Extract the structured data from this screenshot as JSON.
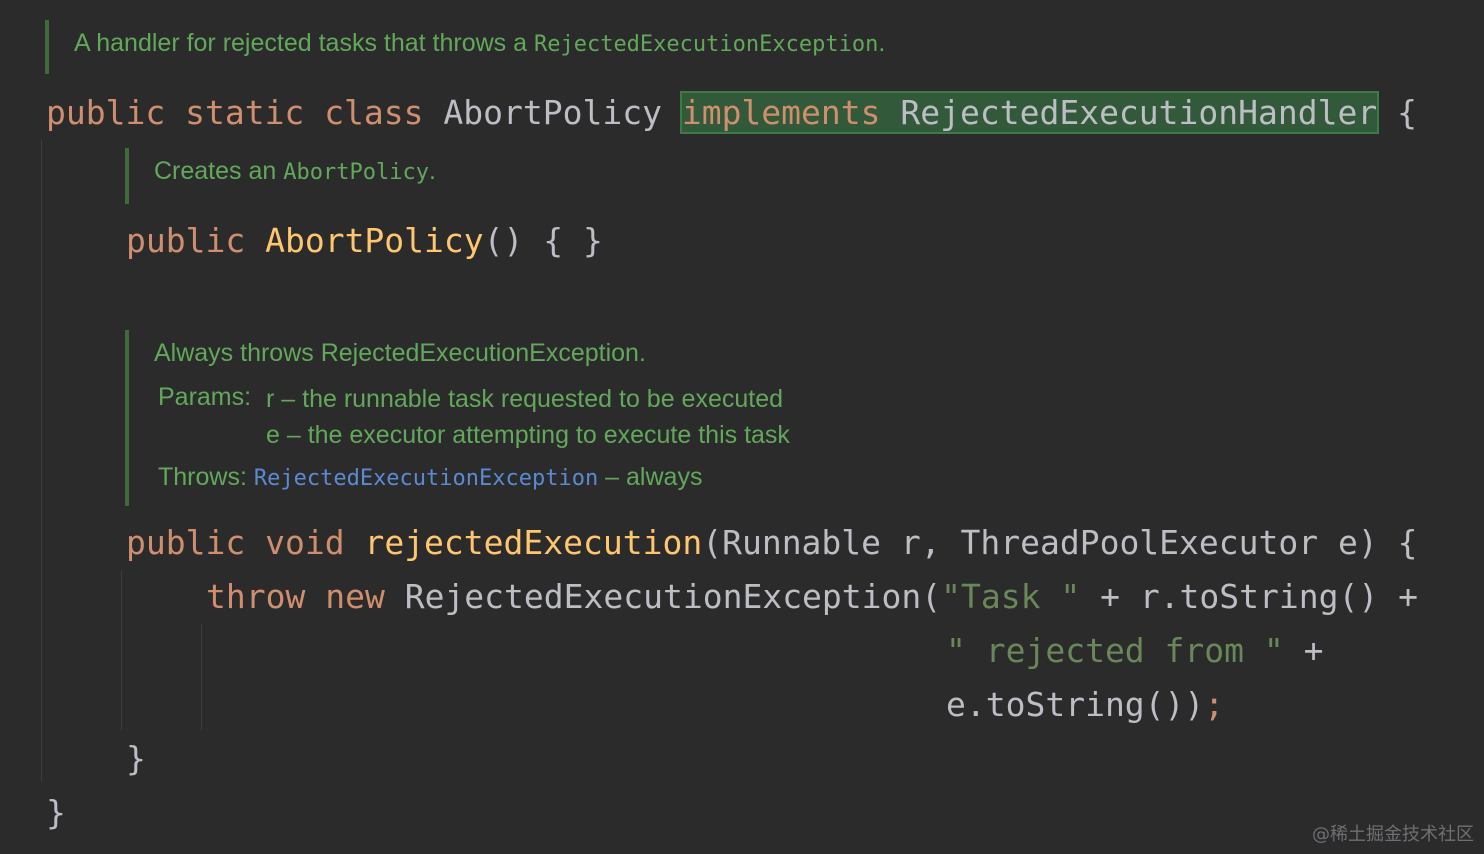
{
  "doc_class": {
    "text_pre": "A handler for rejected tasks that throws a ",
    "text_code": "RejectedExecutionException",
    "text_post": "."
  },
  "class_decl": {
    "kw_public": "public",
    "kw_static": "static",
    "kw_class": "class",
    "class_name": "AbortPolicy",
    "kw_implements": "implements",
    "interface_name": "RejectedExecutionHandler",
    "open_brace": "{"
  },
  "doc_ctor": {
    "text_pre": "Creates an ",
    "text_code": "AbortPolicy",
    "text_post": "."
  },
  "ctor_decl": {
    "kw_public": "public",
    "name": "AbortPolicy",
    "rest": "() { }"
  },
  "doc_method": {
    "summary": "Always throws RejectedExecutionException.",
    "params_label": "Params:",
    "param_r": "r – the runnable task requested to be executed",
    "param_e": "e – the executor attempting to execute this task",
    "throws_label": "Throws:",
    "throws_link": "RejectedExecutionException",
    "throws_rest": " – always"
  },
  "method_decl": {
    "kw_public": "public",
    "kw_void": "void",
    "name": "rejectedExecution",
    "params": "(Runnable r, ThreadPoolExecutor e) {"
  },
  "throw_line": {
    "kw_throw": "throw",
    "kw_new": "new",
    "ctor": "RejectedExecutionException(",
    "str_task": "\"Task \"",
    "rest": " + r.toString() +"
  },
  "cont_line1": {
    "str_rejected": "\" rejected from \"",
    "rest": " +"
  },
  "cont_line2": {
    "expr": "e.toString())",
    "semicolon": ";"
  },
  "method_close": "}",
  "class_close": "}",
  "watermark": "@稀土掘金技术社区"
}
